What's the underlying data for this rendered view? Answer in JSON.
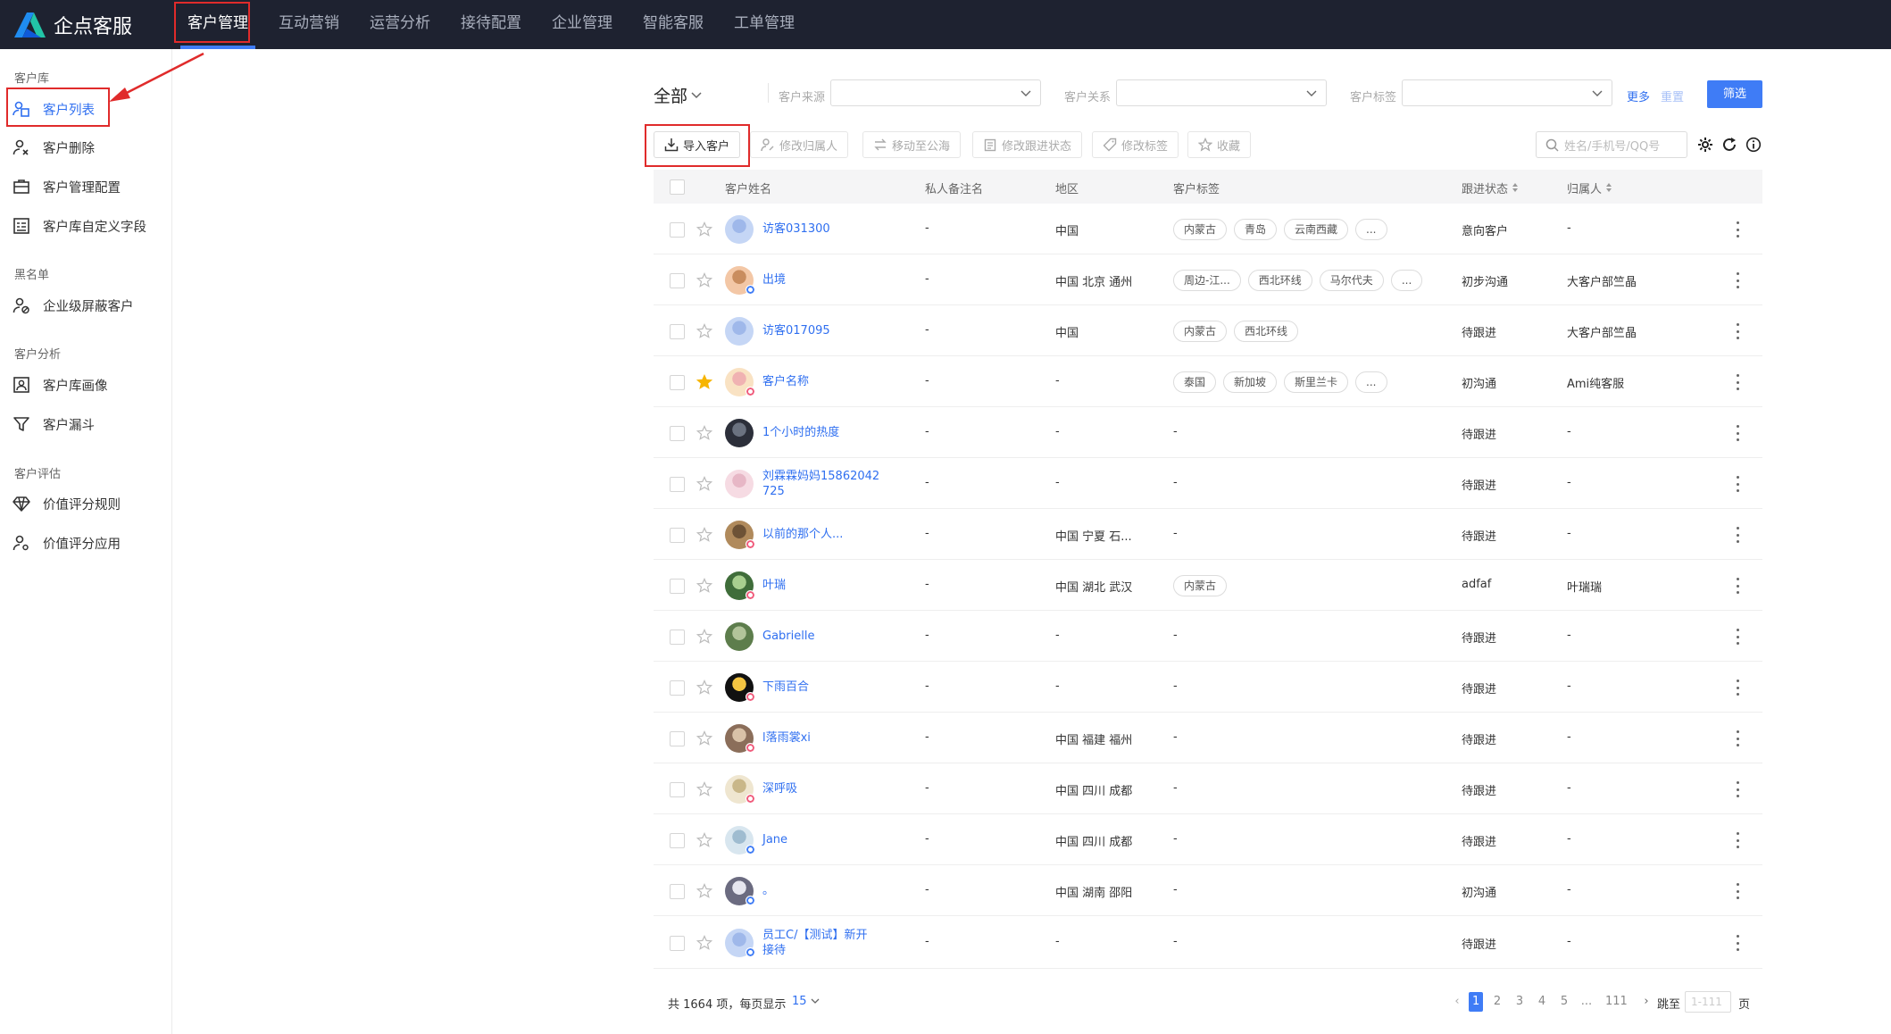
{
  "app": {
    "title": "企点客服"
  },
  "nav": [
    "客户管理",
    "互动营销",
    "运营分析",
    "接待配置",
    "企业管理",
    "智能客服",
    "工单管理"
  ],
  "sidebar": {
    "group1": "客户库",
    "item_list": "客户列表",
    "item_delete": "客户删除",
    "item_config": "客户管理配置",
    "item_fields": "客户库自定义字段",
    "group2": "黑名单",
    "item_block": "企业级屏蔽客户",
    "group3": "客户分析",
    "item_portrait": "客户库画像",
    "item_funnel": "客户漏斗",
    "group4": "客户评估",
    "item_rules": "价值评分规则",
    "item_apply": "价值评分应用"
  },
  "filters": {
    "scope": "全部",
    "source_label": "客户来源",
    "relation_label": "客户关系",
    "tag_label": "客户标签",
    "more": "更多",
    "reset": "重置",
    "submit": "筛选"
  },
  "toolbar": {
    "import": "导入客户",
    "change_owner": "修改归属人",
    "move_public": "移动至公海",
    "change_status": "修改跟进状态",
    "change_tags": "修改标签",
    "favorite": "收藏",
    "search_placeholder": "姓名/手机号/QQ号"
  },
  "table": {
    "headers": {
      "name": "客户姓名",
      "remark": "私人备注名",
      "region": "地区",
      "tags": "客户标签",
      "status": "跟进状态",
      "owner": "归属人"
    },
    "rows": [
      {
        "name1": "访客031300",
        "remark": "-",
        "region": "中国",
        "tags": [
          "内蒙古",
          "青岛",
          "云南西藏",
          "..."
        ],
        "status": "意向客户",
        "owner": "-"
      },
      {
        "name1": "出境",
        "remark": "-",
        "region": "中国 北京 通州",
        "tags": [
          "周边-江...",
          "西北环线",
          "马尔代夫",
          "..."
        ],
        "status": "初步沟通",
        "owner": "大客户部竺晶"
      },
      {
        "name1": "访客017095",
        "remark": "-",
        "region": "中国",
        "tags": [
          "内蒙古",
          "西北环线"
        ],
        "status": "待跟进",
        "owner": "大客户部竺晶"
      },
      {
        "name1": "客户名称",
        "remark": "-",
        "region": "-",
        "tags": [
          "泰国",
          "新加坡",
          "斯里兰卡",
          "..."
        ],
        "status": "初沟通",
        "owner": "Ami纯客服"
      },
      {
        "name1": "1个小时的热度",
        "remark": "-",
        "region": "-",
        "tags_text": "-",
        "status": "待跟进",
        "owner": "-"
      },
      {
        "name1": "刘霖霖妈妈15862042",
        "name2": "725",
        "remark": "-",
        "region": "-",
        "tags_text": "-",
        "status": "待跟进",
        "owner": "-"
      },
      {
        "name1": "以前的那个人...",
        "remark": "-",
        "region": "中国 宁夏 石...",
        "tags_text": "-",
        "status": "待跟进",
        "owner": "-"
      },
      {
        "name1": "叶瑞",
        "remark": "-",
        "region": "中国 湖北 武汉",
        "tags": [
          "内蒙古"
        ],
        "status": "adfaf",
        "owner": "叶瑞瑞"
      },
      {
        "name1": "Gabrielle",
        "remark": "-",
        "region": "-",
        "tags_text": "-",
        "status": "待跟进",
        "owner": "-"
      },
      {
        "name1": "下雨百合",
        "remark": "-",
        "region": "-",
        "tags_text": "-",
        "status": "待跟进",
        "owner": "-"
      },
      {
        "name1": "l落雨裳xi",
        "remark": "-",
        "region": "中国 福建 福州",
        "tags_text": "-",
        "status": "待跟进",
        "owner": "-"
      },
      {
        "name1": "深呼吸",
        "remark": "-",
        "region": "中国 四川 成都",
        "tags_text": "-",
        "status": "待跟进",
        "owner": "-"
      },
      {
        "name1": "Jane",
        "remark": "-",
        "region": "中国 四川 成都",
        "tags_text": "-",
        "status": "待跟进",
        "owner": "-"
      },
      {
        "name1": "。",
        "remark": "-",
        "region": "中国 湖南 邵阳",
        "tags_text": "-",
        "status": "初沟通",
        "owner": "-"
      },
      {
        "name1": "员工C/【测试】新开",
        "name2": "接待",
        "remark": "-",
        "region": "-",
        "tags_text": "-",
        "status": "待跟进",
        "owner": "-"
      }
    ]
  },
  "pagination": {
    "total_text": "共 1664 项，每页显示",
    "page_size": "15",
    "pages": [
      "1",
      "2",
      "3",
      "4",
      "5",
      "...",
      "111"
    ],
    "jump_label": "跳至",
    "jump_placeholder": "1-111",
    "page_unit": "页"
  },
  "colors": {
    "accent": "#3f7cf6",
    "topbar": "#1e2230",
    "highlight": "#e02b2b"
  }
}
